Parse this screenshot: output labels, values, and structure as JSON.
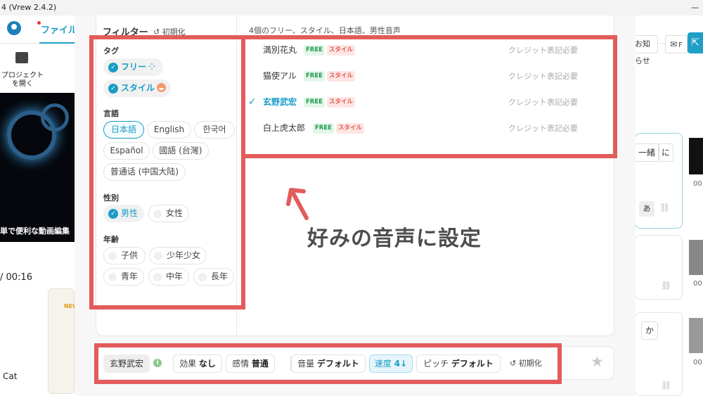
{
  "window": {
    "title": "4 (Vrew 2.4.2)",
    "minimize": "—"
  },
  "app": {
    "tab_file": "ファイル",
    "open_project": "プロジェクトを開く",
    "notice_label": "お知らせ",
    "mail_label": "F",
    "video_caption": "単で便利な動画編集",
    "timecode": "/ 00:16",
    "new_badge": "NEW",
    "cat_label": "Cat",
    "right_card_btn1": "一緒",
    "right_card_btn2": "に",
    "right_card_a": "あ",
    "right_kana": "か",
    "rnum": "00"
  },
  "filter": {
    "title": "フィルター",
    "reset": "初期化",
    "tag_label": "タグ",
    "tags": [
      "フリー",
      "スタイル"
    ],
    "language_label": "言語",
    "languages": [
      "日本語",
      "English",
      "한국어",
      "Español",
      "國語 (台灣)",
      "普通话 (中国大陆)"
    ],
    "selected_language": "日本語",
    "gender_label": "性別",
    "genders": [
      "男性",
      "女性"
    ],
    "selected_gender": "男性",
    "age_label": "年齢",
    "ages": [
      "子供",
      "少年少女",
      "青年",
      "中年",
      "長年"
    ]
  },
  "results": {
    "title": "4個のフリー、スタイル、日本語、男性音声",
    "free_badge": "FREE",
    "style_badge": "スタイル",
    "voices": [
      {
        "name": "満別花丸",
        "credit": "クレジット表記必要",
        "selected": false
      },
      {
        "name": "猫使アル",
        "credit": "クレジット表記必要",
        "selected": false
      },
      {
        "name": "玄野武宏",
        "credit": "クレジット表記必要",
        "selected": true
      },
      {
        "name": "白上虎太郎",
        "credit": "クレジット表記必要",
        "selected": false
      }
    ]
  },
  "annotation": "好みの音声に設定",
  "bottom_bar": {
    "speaker": "玄野武宏",
    "effect_label": "効果",
    "effect_value": "なし",
    "emotion_label": "感情",
    "emotion_value": "普通",
    "volume_label": "音量",
    "volume_value": "デフォルト",
    "speed_label": "速度",
    "speed_value": "4↓",
    "pitch_label": "ピッチ",
    "pitch_value": "デフォルト",
    "reset": "初期化"
  },
  "colors": {
    "accent": "#1a9cc6",
    "highlight_box": "#e35b5b",
    "free": "#1f9b4e",
    "style": "#e4574d"
  }
}
